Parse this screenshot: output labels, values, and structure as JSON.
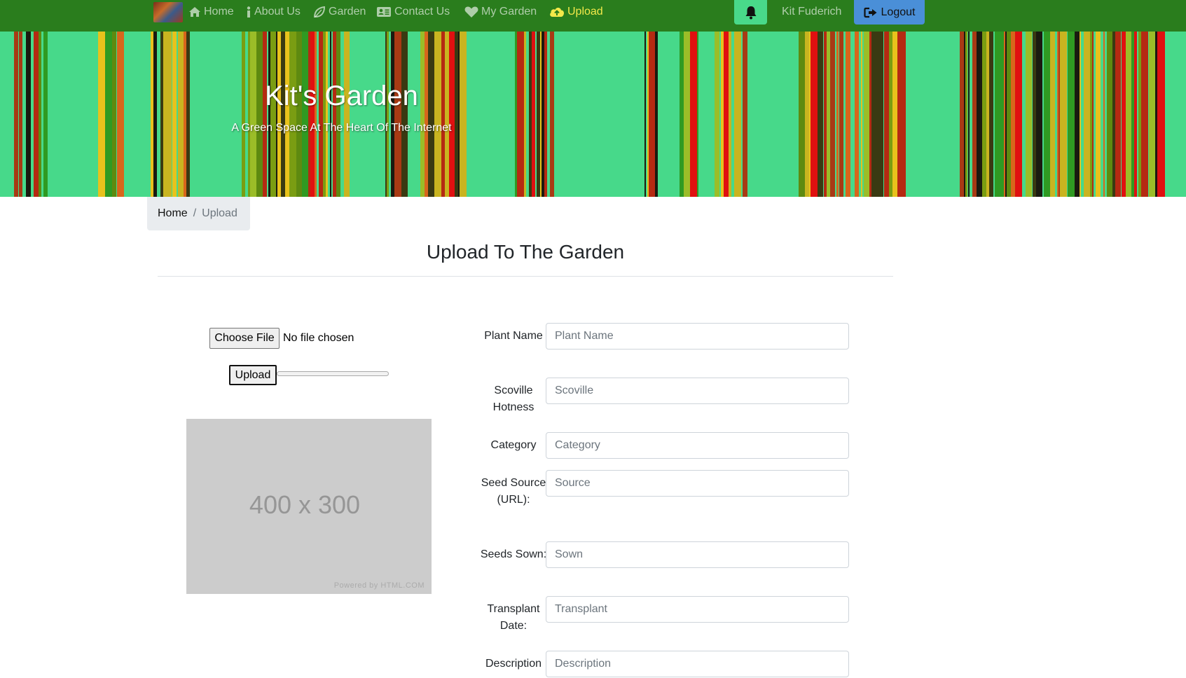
{
  "nav": {
    "items": [
      {
        "label": "Home",
        "icon": "home-icon"
      },
      {
        "label": "About Us",
        "icon": "info-icon"
      },
      {
        "label": "Garden",
        "icon": "leaf-icon"
      },
      {
        "label": "Contact Us",
        "icon": "contact-card-icon"
      },
      {
        "label": "My Garden",
        "icon": "heart-icon"
      },
      {
        "label": "Upload",
        "icon": "cloud-upload-icon",
        "active": true
      }
    ],
    "user_name": "Kit Fuderich",
    "logout_label": "Logout",
    "bell_icon": "bell-icon",
    "colors": {
      "background": "#2a7d1d",
      "active": "#f3e94a",
      "bell": "#49d98a",
      "logout": "#4a8fd8"
    }
  },
  "hero": {
    "title": "Kit's Garden",
    "subtitle": "A Green Space At The Heart Of The Internet",
    "background_color": "#47d98a"
  },
  "breadcrumb": {
    "home": "Home",
    "separator": "/",
    "current": "Upload"
  },
  "page": {
    "title": "Upload To The Garden"
  },
  "uploader": {
    "choose_file_label": "Choose File",
    "file_status": "No file chosen",
    "upload_label": "Upload",
    "progress": 0,
    "placeholder_size": "400 x 300",
    "placeholder_credit": "Powered by HTML.COM"
  },
  "form": {
    "fields": [
      {
        "label": "Plant Name",
        "placeholder": "Plant Name"
      },
      {
        "label": "Scoville Hotness",
        "placeholder": "Scoville"
      },
      {
        "label": "Category",
        "placeholder": "Category"
      },
      {
        "label": "Seed Source (URL):",
        "placeholder": "Source"
      },
      {
        "label": "Seeds Sown:",
        "placeholder": "Sown"
      },
      {
        "label": "Transplant Date:",
        "placeholder": "Transplant"
      },
      {
        "label": "Description",
        "placeholder": "Description"
      }
    ]
  }
}
